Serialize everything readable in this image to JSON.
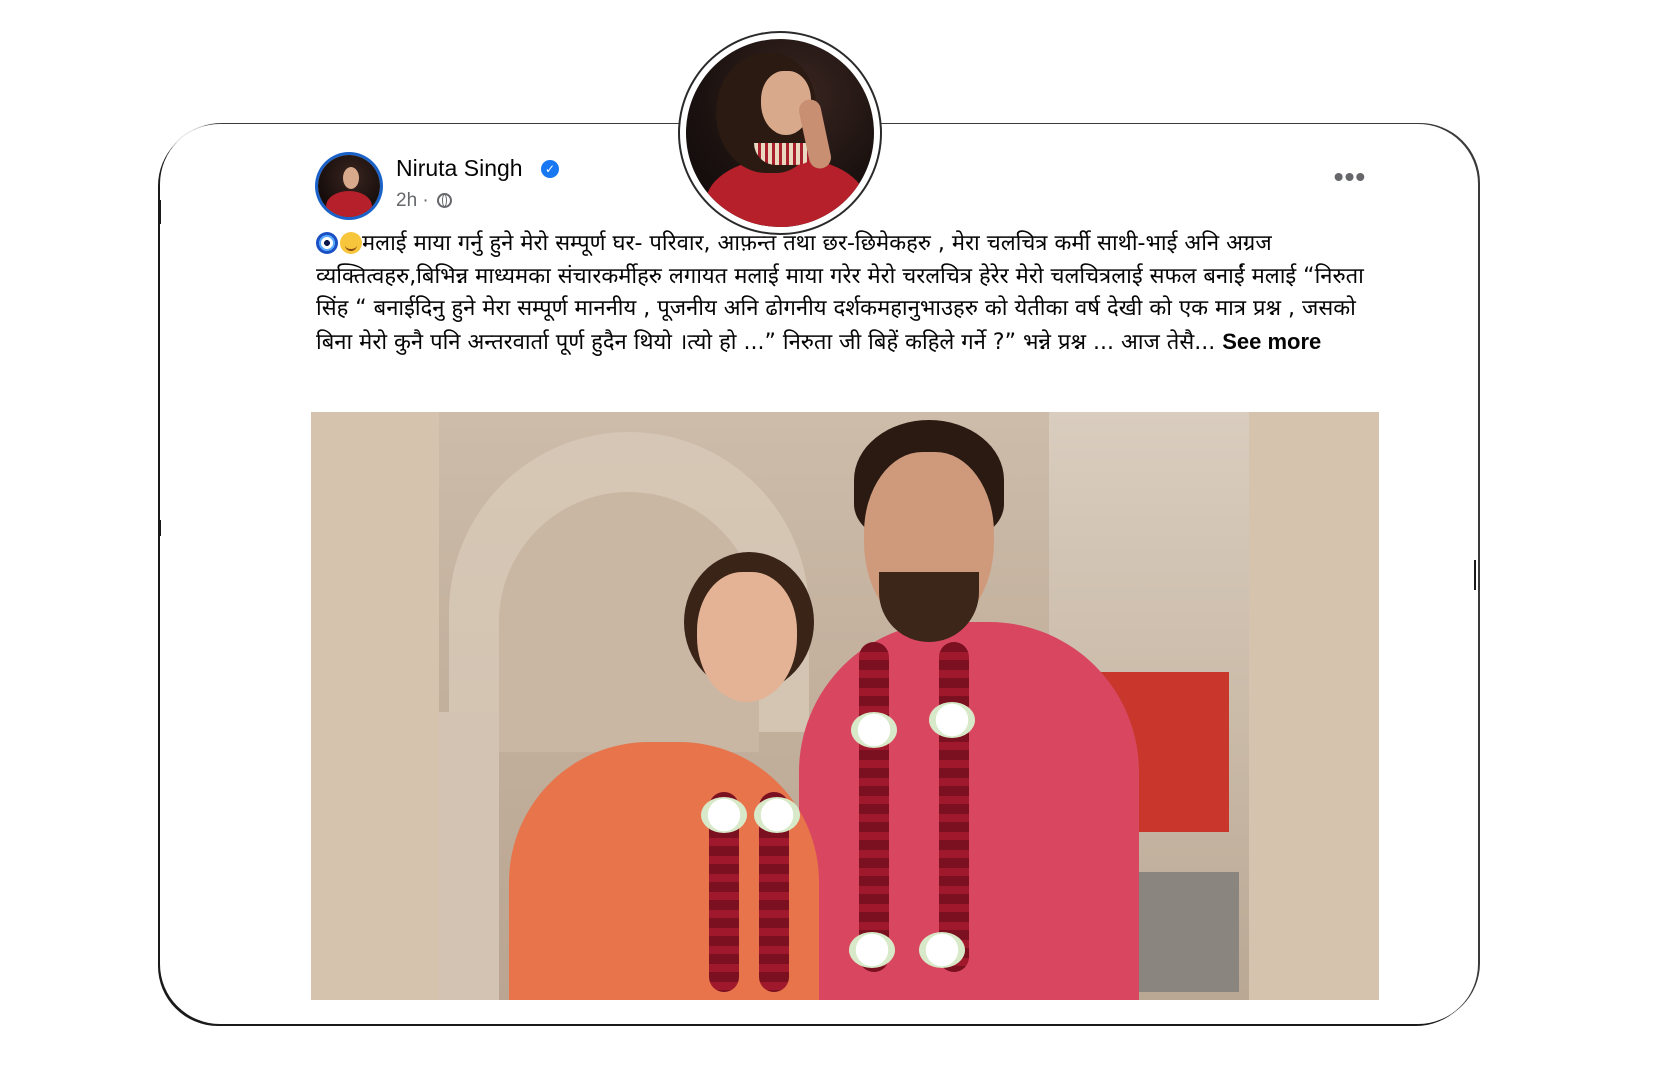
{
  "post": {
    "author": "Niruta Singh",
    "time": "2h",
    "separator": "·",
    "more_label": "•••",
    "text": "मलाई माया गर्नु हुने मेरो सम्पूर्ण  घर- परिवार, आफ़न्त तथा छर-छिमेकहरु , मेरा चलचित्र कर्मी साथी-भाई अनि अग्रज व्यक्तित्वहरु,बिभिन्न माध्यमका संचारकर्मीहरु लगायत मलाई माया गरेर मेरो चरलचित्र हेरेर  मेरो चलचित्रलाई सफल बनाईं मलाई “निरुता सिंह “ बनाईदिनु हुने मेरा सम्पूर्ण माननीय , पूजनीय अनि ढोगनीय दर्शकमहानुभाउहरु को येतीका वर्ष देखी को  एक मात्र प्रश्न , जसको बिना  मेरो कुनै पनि अन्तरवार्ता पूर्ण हुदैन थियो ।त्यो हो ...” निरुता जी बिहें कहिले गर्ने  ?” भन्ने प्रश्न ... आज तेसै...",
    "see_more": "See more",
    "verified_mark": "✓"
  },
  "icons": {
    "verified": "verified-badge-icon",
    "audience": "globe-icon",
    "more": "more-options-icon",
    "emoji_1": "nazar-amulet-emoji",
    "emoji_2": "relieved-face-emoji"
  },
  "colors": {
    "verified_blue": "#1877f2",
    "meta_gray": "#65676b",
    "text_black": "#050505",
    "avatar_ring": "#1a62c9",
    "image_background": "#d6c3ad"
  }
}
